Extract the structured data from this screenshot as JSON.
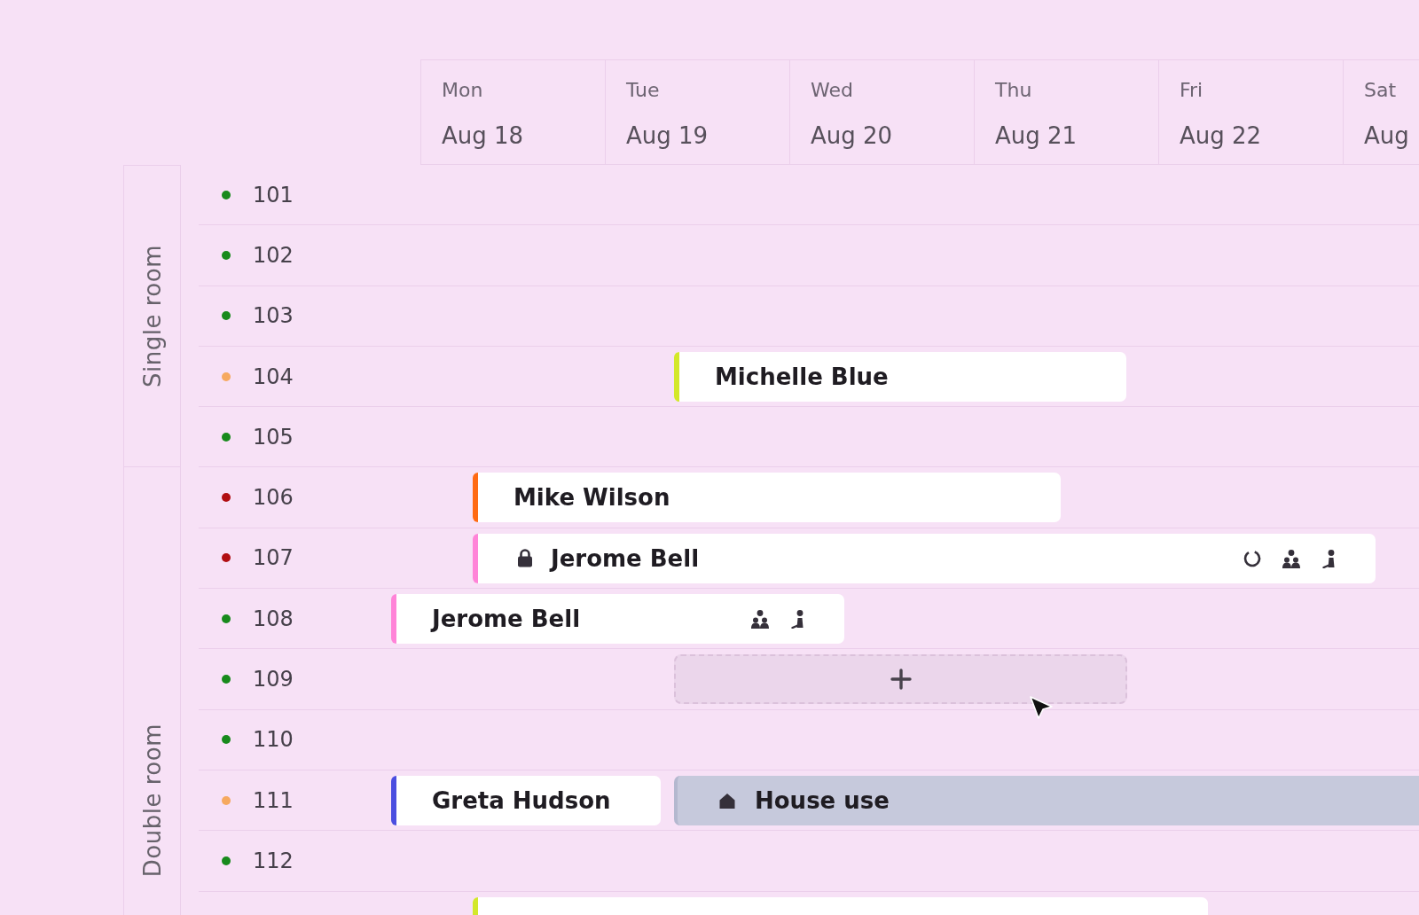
{
  "calendar": {
    "days": [
      {
        "weekday": "Mon",
        "date": "Aug 18"
      },
      {
        "weekday": "Tue",
        "date": "Aug 19"
      },
      {
        "weekday": "Wed",
        "date": "Aug 20"
      },
      {
        "weekday": "Thu",
        "date": "Aug 21"
      },
      {
        "weekday": "Fri",
        "date": "Aug 22"
      },
      {
        "weekday": "Sat",
        "date": "Aug"
      }
    ],
    "room_groups": [
      {
        "label": "Single room",
        "rooms": [
          {
            "number": "101",
            "color": "#188a1c"
          },
          {
            "number": "102",
            "color": "#188a1c"
          },
          {
            "number": "103",
            "color": "#188a1c"
          },
          {
            "number": "104",
            "color": "#f6a95f",
            "bookings": [
              {
                "kind": "guest",
                "guest": "Michelle Blue",
                "color": "#d3e82a",
                "locked": false
              }
            ]
          },
          {
            "number": "105",
            "color": "#188a1c"
          }
        ]
      },
      {
        "label": "Double room",
        "rooms": [
          {
            "number": "106",
            "color": "#b10e12",
            "bookings": [
              {
                "kind": "guest",
                "guest": "Mike Wilson",
                "color": "#ff6a13",
                "locked": false
              }
            ]
          },
          {
            "number": "107",
            "color": "#b10e12",
            "bookings": [
              {
                "kind": "guest",
                "guest": "Jerome Bell",
                "color": "#ff84d8",
                "locked": true,
                "markers": [
                  {
                    "kind": "ring"
                  },
                  {
                    "kind": "people"
                  },
                  {
                    "kind": "person"
                  }
                ]
              }
            ]
          },
          {
            "number": "108",
            "color": "#188a1c",
            "bookings": [
              {
                "kind": "guest",
                "guest": "Jerome Bell",
                "color": "#ff84d8",
                "locked": false,
                "markers": [
                  {
                    "kind": "people"
                  },
                  {
                    "kind": "person"
                  }
                ]
              }
            ]
          },
          {
            "number": "109",
            "color": "#188a1c",
            "bookings": [
              {
                "kind": "add"
              }
            ]
          },
          {
            "number": "110",
            "color": "#188a1c"
          },
          {
            "number": "111",
            "color": "#f6a95f",
            "bookings": [
              {
                "kind": "guest",
                "guest": "Greta Hudson",
                "color": "#4b4ee0",
                "locked": false
              },
              {
                "kind": "block",
                "label": "House use"
              }
            ]
          },
          {
            "number": "112",
            "color": "#188a1c"
          },
          {
            "bookings": [
              {
                "kind": "guest",
                "color": "#d3e82a",
                "locked": false
              }
            ]
          }
        ]
      }
    ]
  }
}
